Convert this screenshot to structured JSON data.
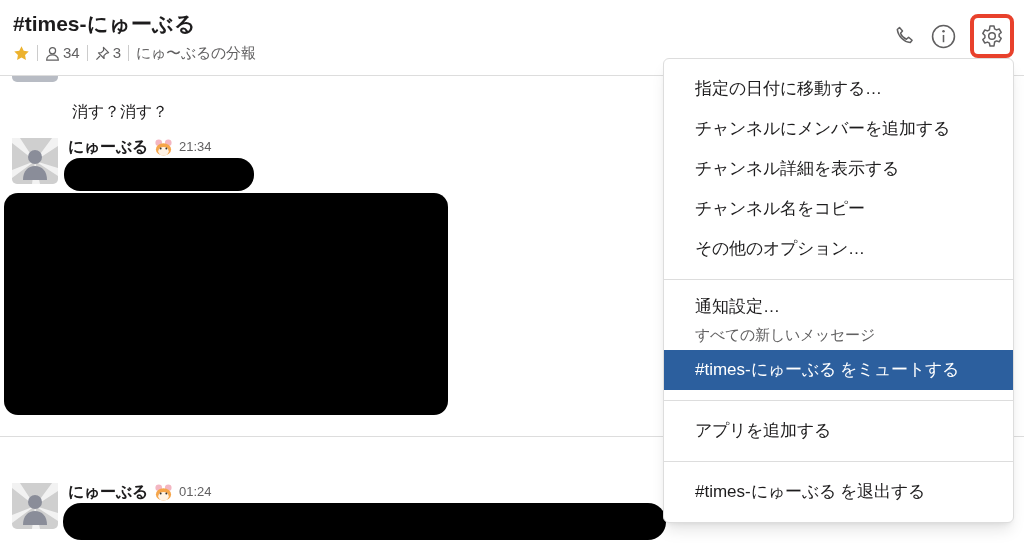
{
  "channel": {
    "name": "#times-にゅーぶる",
    "starred": true,
    "members": "34",
    "pins": "3",
    "topic": "にゅ〜ぶるの分報"
  },
  "messages": [
    {
      "kind": "cut"
    },
    {
      "kind": "text",
      "text": "消す？消す？"
    },
    {
      "kind": "post",
      "author": "にゅーぶる",
      "time": "21:34",
      "blocks": [
        {
          "kind": "line"
        },
        {
          "kind": "image"
        }
      ]
    },
    {
      "kind": "divider"
    },
    {
      "kind": "post",
      "author": "にゅーぶる",
      "time": "01:24",
      "blocks": [
        {
          "kind": "wide"
        }
      ]
    }
  ],
  "settings_button": {
    "highlighted": true
  },
  "menu": {
    "sections": [
      {
        "items": [
          {
            "label": "指定の日付に移動する…",
            "selected": false
          },
          {
            "label": "チャンネルにメンバーを追加する",
            "selected": false
          },
          {
            "label": "チャンネル詳細を表示する",
            "selected": false
          },
          {
            "label": "チャンネル名をコピー",
            "selected": false
          },
          {
            "label": "その他のオプション…",
            "selected": false
          }
        ]
      },
      {
        "items": [
          {
            "label": "通知設定…",
            "sublabel": "すべての新しいメッセージ",
            "selected": false
          },
          {
            "label": "#times-にゅーぶる をミュートする",
            "selected": true
          }
        ]
      },
      {
        "items": [
          {
            "label": "アプリを追加する",
            "selected": false
          }
        ]
      },
      {
        "items": [
          {
            "label": "#times-にゅーぶる を退出する",
            "selected": false
          }
        ]
      }
    ]
  }
}
